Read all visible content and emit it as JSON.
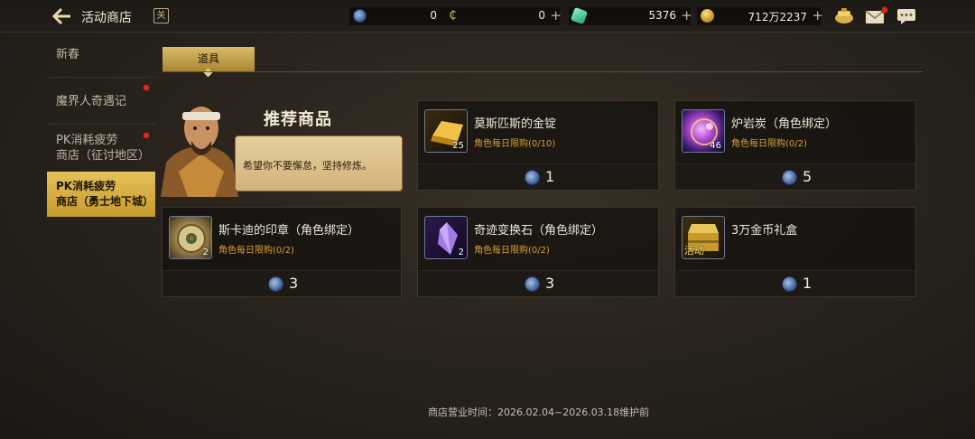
{
  "header": {
    "title": "活动商店",
    "calendar_char": "关",
    "currencies": [
      {
        "icon": "fatigue-coin-icon",
        "value": "0"
      },
      {
        "icon": "c-coin-icon",
        "value": "0"
      },
      {
        "icon": "gem-icon",
        "value": "5376"
      },
      {
        "icon": "gold-coin-icon",
        "value": "712万2237"
      }
    ],
    "plus": "+"
  },
  "sidebar": {
    "items": [
      {
        "label": "新春"
      },
      {
        "label": "魔界人奇遇记"
      },
      {
        "label": "PK消耗疲劳商店（征讨地区）"
      },
      {
        "label": "PK消耗疲劳商店（勇士地下城）"
      }
    ],
    "item2_line1": "PK消耗疲劳",
    "item2_line2": "商店（征讨地区）",
    "item3_line1": "PK消耗疲劳",
    "item3_line2": "商店（勇士地下城）"
  },
  "tabs": {
    "items_label": "道具"
  },
  "recommend": {
    "title": "推荐商品",
    "speech": "希望你不要懈怠，坚持修炼。"
  },
  "products": [
    {
      "name": "莫斯匹斯的金锭",
      "count": "25",
      "limit": "角色每日限购(0/10)",
      "price": "1",
      "icon": "gold-ingot-icon"
    },
    {
      "name": "炉岩炭（角色绑定）",
      "count": "46",
      "limit": "角色每日限购(0/2)",
      "price": "5",
      "icon": "furnace-charcoal-icon"
    },
    {
      "name": "斯卡迪的印章（角色绑定）",
      "count": "2",
      "limit": "角色每日限购(0/2)",
      "price": "3",
      "icon": "seal-icon"
    },
    {
      "name": "奇迹变换石（角色绑定）",
      "count": "2",
      "limit": "角色每日限购(0/2)",
      "price": "3",
      "icon": "crystal-icon"
    },
    {
      "name": "3万金币礼盒",
      "count": "",
      "limit": "",
      "price": "1",
      "icon": "gold-chest-icon",
      "badge": "活动"
    }
  ],
  "footer": {
    "text": "商店营业时间：2026.02.04~2026.03.18维护前"
  },
  "colors": {
    "accent": "#d9bb6a",
    "limit": "#d8a038",
    "reddot": "#e02a1e",
    "background": "#2a241d"
  }
}
